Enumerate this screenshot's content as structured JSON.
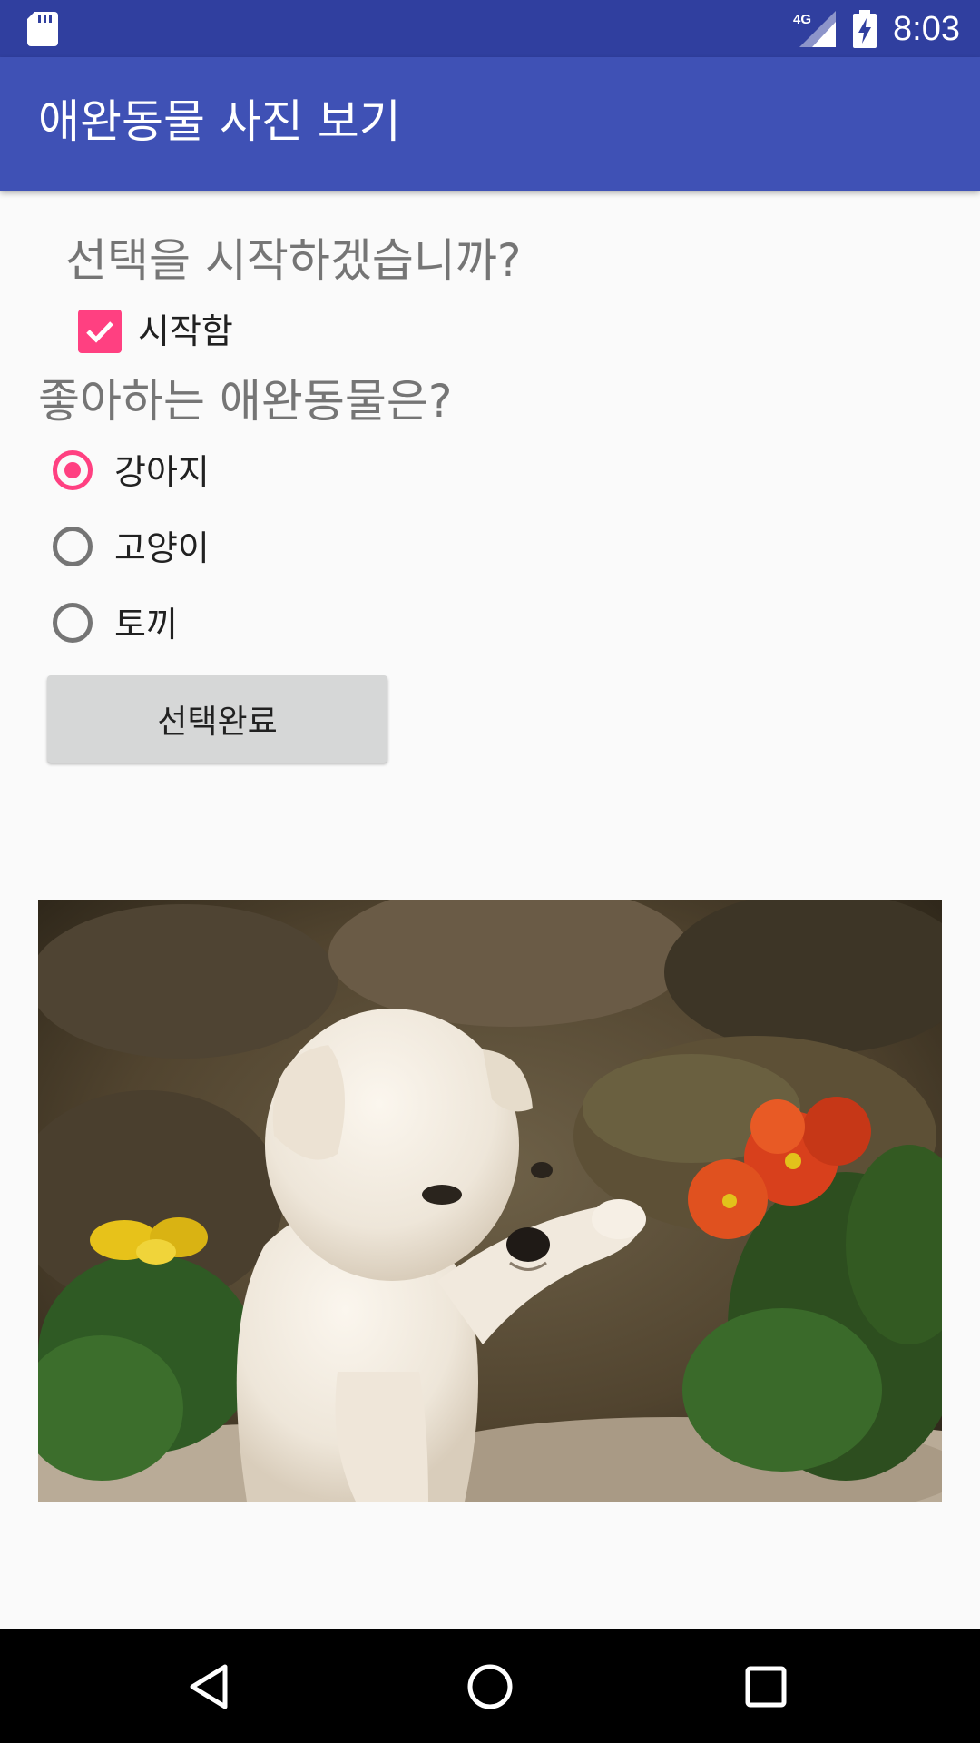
{
  "status_bar": {
    "time": "8:03",
    "network": "4G",
    "icons": [
      "sd-card-icon",
      "signal-icon",
      "battery-charging-icon"
    ]
  },
  "app_bar": {
    "title": "애완동물 사진 보기"
  },
  "form": {
    "question_start": "선택을 시작하겠습니까?",
    "start_checkbox": {
      "label": "시작함",
      "checked": true
    },
    "question_pet": "좋아하는 애완동물은?",
    "options": [
      {
        "label": "강아지",
        "selected": true
      },
      {
        "label": "고양이",
        "selected": false
      },
      {
        "label": "토끼",
        "selected": false
      }
    ],
    "submit_label": "선택완료"
  },
  "image": {
    "subject": "puppy-photo"
  },
  "nav_bar": {
    "icons": [
      "back-icon",
      "home-icon",
      "recents-icon"
    ]
  },
  "colors": {
    "status_bar": "#303f9f",
    "app_bar": "#3f51b5",
    "accent": "#ff4081",
    "background": "#fafafa",
    "button": "#d6d7d7"
  }
}
